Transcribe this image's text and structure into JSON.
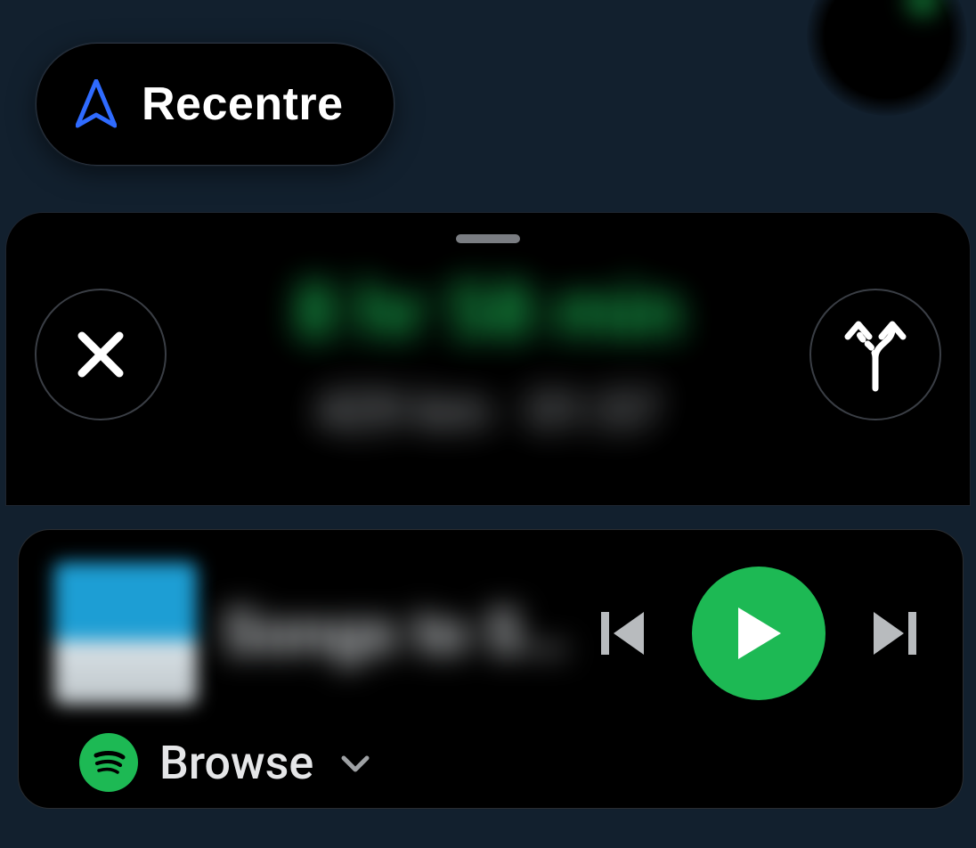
{
  "colors": {
    "accent_green": "#1db954",
    "nav_blue": "#2f6bff"
  },
  "recentre": {
    "label": "Recentre"
  },
  "nav_card": {
    "eta_primary": "8 hr 58 min",
    "eta_secondary": "429 km · 01:57"
  },
  "media": {
    "track_title": "Songs to S…",
    "browse_label": "Browse"
  }
}
